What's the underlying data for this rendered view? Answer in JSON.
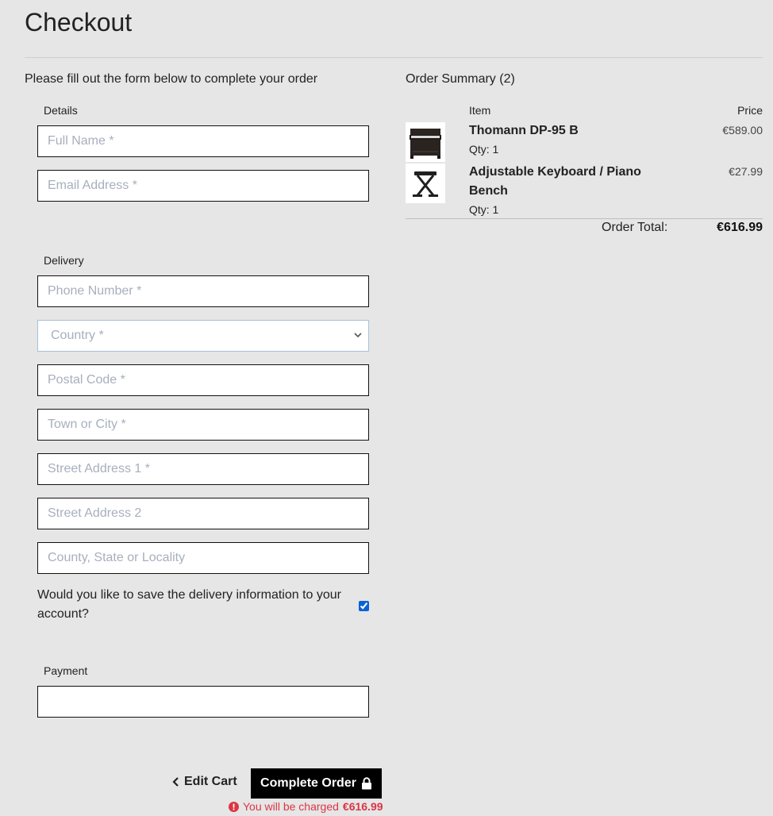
{
  "page": {
    "title": "Checkout",
    "intro": "Please fill out the form below to complete your order"
  },
  "details": {
    "label": "Details",
    "full_name_placeholder": "Full Name *",
    "email_placeholder": "Email Address *"
  },
  "delivery": {
    "label": "Delivery",
    "phone_placeholder": "Phone Number *",
    "country_value": "Country *",
    "postal_placeholder": "Postal Code *",
    "town_placeholder": "Town or City *",
    "street1_placeholder": "Street Address 1 *",
    "street2_placeholder": "Street Address 2",
    "county_placeholder": "County, State or Locality",
    "save_question": "Would you like to save the delivery information to your account?",
    "save_checked": true
  },
  "payment": {
    "label": "Payment"
  },
  "actions": {
    "edit_cart_label": "Edit Cart",
    "complete_label": "Complete Order",
    "charge_prefix": "You will be charged",
    "charge_amount": "€616.99"
  },
  "summary": {
    "title": "Order Summary (2)",
    "col_item": "Item",
    "col_price": "Price",
    "items": [
      {
        "name": "Thomann DP-95 B",
        "qty": "Qty: 1",
        "price": "€589.00",
        "image_icon": "digital-piano-image"
      },
      {
        "name": "Adjustable Keyboard / Piano Bench",
        "qty": "Qty: 1",
        "price": "€27.99",
        "image_icon": "piano-bench-image"
      }
    ],
    "total_label": "Order Total:",
    "total_value": "€616.99"
  },
  "colors": {
    "background": "#e6e6e6",
    "button_bg": "#000000",
    "error_red": "#dc3545",
    "checkbox_blue": "#0b62d6"
  }
}
